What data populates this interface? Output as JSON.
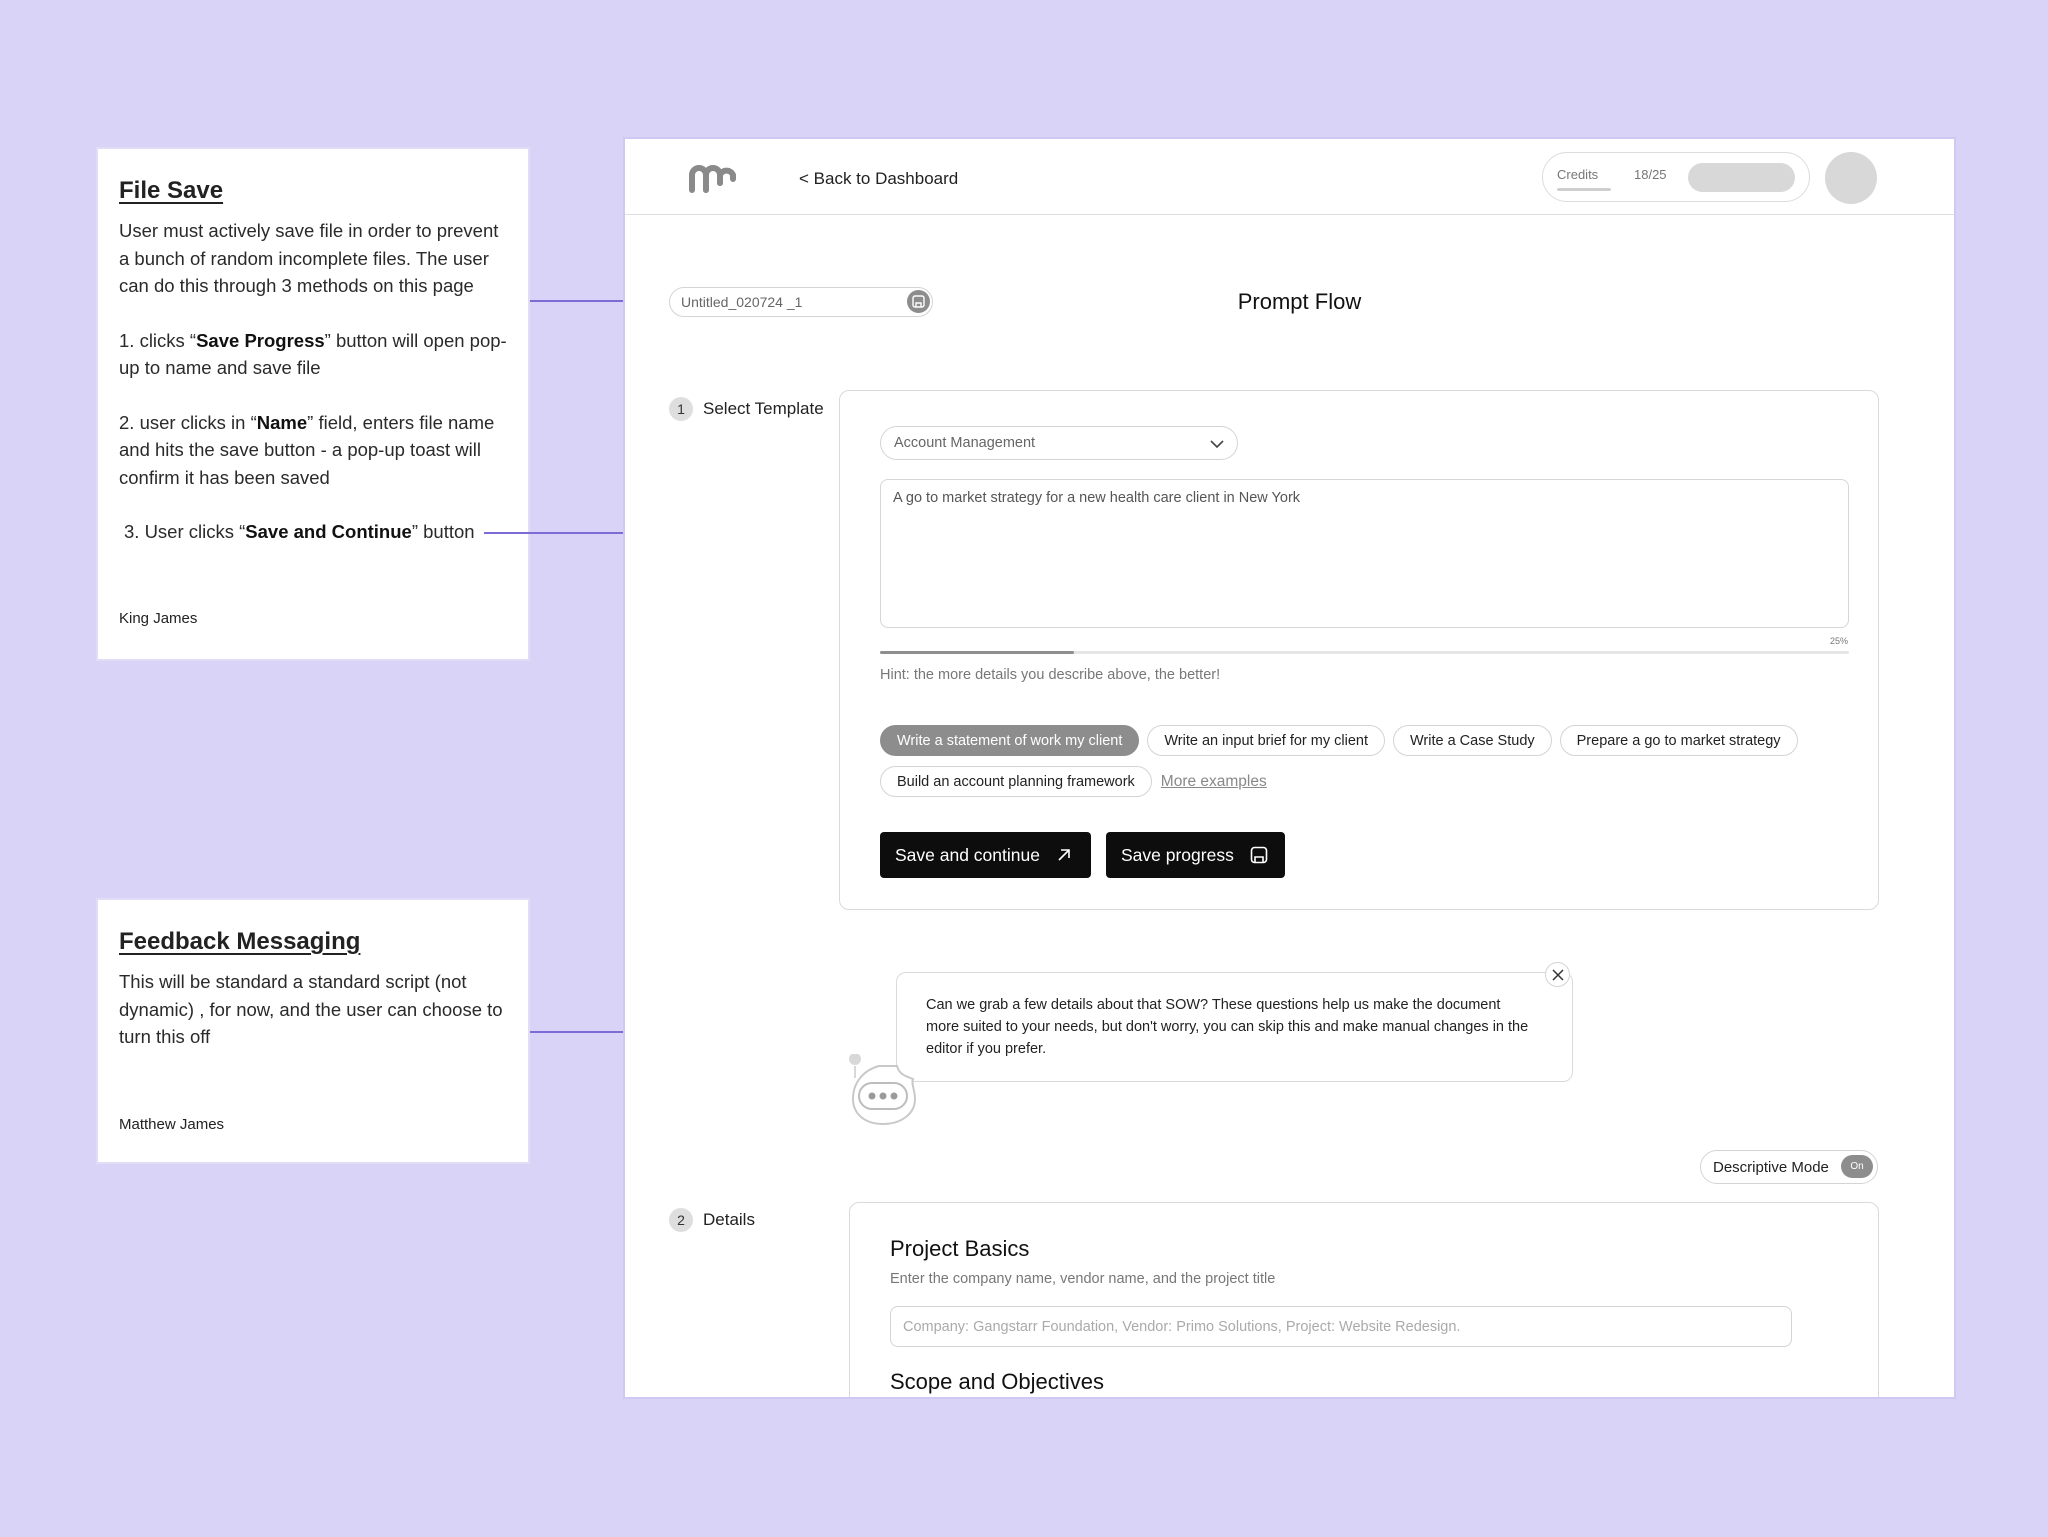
{
  "annotations": {
    "file_save": {
      "title": "File Save",
      "intro": "User must actively save file in order to prevent a bunch of random incomplete files. The user can do this through 3 methods on this page",
      "step1_pre": "1. clicks “",
      "step1_bold": "Save Progress",
      "step1_post": "” button will open pop-up to name and save file",
      "step2_pre": "2. user clicks in “",
      "step2_bold": "Name",
      "step2_post": "” field, enters file name and hits the save button - a pop-up toast will confirm it has been saved",
      "step3_pre": "3. User clicks “",
      "step3_bold": "Save and Continue",
      "step3_post": "” button",
      "author": "King James"
    },
    "feedback": {
      "title": "Feedback Messaging",
      "body": "This will be standard a standard script (not dynamic) , for now,  and the user can choose to turn this off",
      "author": "Matthew James"
    }
  },
  "header": {
    "back_link": "< Back to Dashboard",
    "credits_label": "Credits",
    "credits_count": "18/25"
  },
  "file": {
    "name_value": "Untitled_020724 _1"
  },
  "page_title": "Prompt Flow",
  "step1": {
    "number": "1",
    "label": "Select Template",
    "template_select": "Account Management",
    "prompt_text": "A go to market strategy for a new health care client in New York",
    "progress_label": "25%",
    "progress_value": 0.2,
    "hint": "Hint: the more details you describe above, the better!",
    "chips_row1": [
      "Write a statement of work my client",
      "Write an input brief for my client",
      "Write a Case Study",
      "Prepare a go to market strategy"
    ],
    "chips_row2": [
      "Build an account planning framework"
    ],
    "active_chip_index": 0,
    "more_examples": "More examples",
    "save_continue": "Save and continue",
    "save_progress": "Save progress"
  },
  "feedback_bubble": {
    "text": "Can we grab a few details about that SOW? These questions help us make the document more suited to your needs, but don't worry, you can skip this and make manual changes in the editor if you prefer."
  },
  "descriptive_mode": {
    "label": "Descriptive Mode",
    "state": "On"
  },
  "step2": {
    "number": "2",
    "label": "Details",
    "basics_title": "Project Basics",
    "basics_sub": "Enter the company name, vendor name, and the project title",
    "basics_placeholder": "Company: Gangstarr Foundation, Vendor: Primo Solutions, Project: Website Redesign.",
    "scope_title": "Scope and Objectives"
  },
  "colors": {
    "background": "#d9d3f7",
    "connector": "#7b6cd6",
    "primary_button": "#0d0d0d",
    "active_chip": "#8d8d8d"
  },
  "icons": [
    "logo",
    "save-icon",
    "chevron-down-icon",
    "arrow-up-right-icon",
    "close-icon",
    "chatbot-icon"
  ]
}
